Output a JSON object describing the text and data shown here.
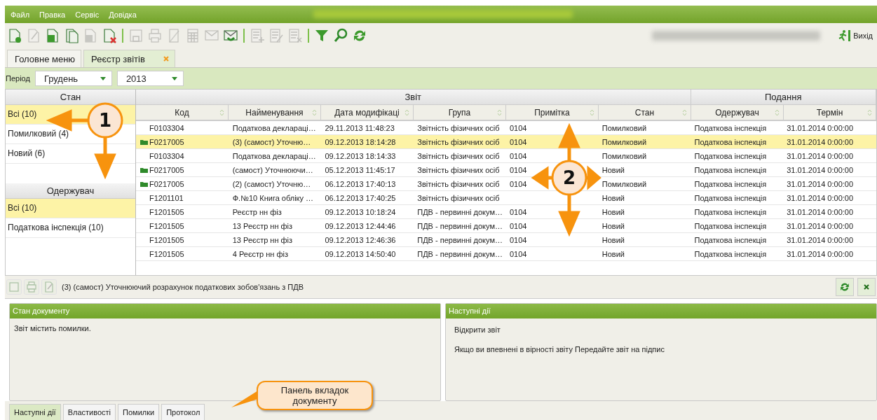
{
  "menu": [
    "Файл",
    "Правка",
    "Сервіс",
    "Довідка"
  ],
  "toolbar": [
    {
      "kind": "doc-add",
      "disabled": false
    },
    {
      "kind": "doc-edit",
      "disabled": true
    },
    {
      "kind": "doc-open",
      "disabled": false
    },
    {
      "kind": "doc-copy",
      "disabled": false
    },
    {
      "kind": "doc-sign",
      "disabled": true
    },
    {
      "kind": "doc-delete",
      "disabled": false
    },
    {
      "kind": "separator"
    },
    {
      "kind": "save",
      "disabled": true
    },
    {
      "kind": "print",
      "disabled": true
    },
    {
      "kind": "pen",
      "disabled": true
    },
    {
      "kind": "grid",
      "disabled": true
    },
    {
      "kind": "mail-send",
      "disabled": true
    },
    {
      "kind": "mail-receive",
      "disabled": false
    },
    {
      "kind": "separator"
    },
    {
      "kind": "list-add",
      "disabled": true
    },
    {
      "kind": "list-edit",
      "disabled": true
    },
    {
      "kind": "list-delete",
      "disabled": true
    },
    {
      "kind": "separator"
    },
    {
      "kind": "filter",
      "disabled": false
    },
    {
      "kind": "search",
      "disabled": false
    },
    {
      "kind": "refresh",
      "disabled": false
    }
  ],
  "exit_button": {
    "label": "Вихід"
  },
  "tabs": [
    {
      "label": "Головне меню",
      "selected": false,
      "closable": false
    },
    {
      "label": "Реєстр звітів",
      "selected": true,
      "closable": true
    }
  ],
  "period": {
    "label": "Період",
    "month": "Грудень",
    "year": "2013"
  },
  "filters": [
    {
      "title": "Стан",
      "items": [
        {
          "label": "Всі (10)",
          "selected": true
        },
        {
          "label": "Помилковий (4)",
          "selected": false
        },
        {
          "label": "Новий (6)",
          "selected": false
        }
      ]
    },
    {
      "title": "Одержувач",
      "items": [
        {
          "label": "Всі (10)",
          "selected": true
        },
        {
          "label": "Податкова інспекція (10)",
          "selected": false
        }
      ]
    }
  ],
  "table": {
    "column_groups": [
      {
        "label": "Звіт"
      },
      {
        "label": "Подання"
      }
    ],
    "columns": [
      "Код",
      "Найменування",
      "Дата модифікаці",
      "Група",
      "Примітка",
      "Стан",
      "Одержувач",
      "Термін"
    ],
    "rows": [
      {
        "folder": false,
        "selected": false,
        "cells": [
          "F0103304",
          "Податкова деклараці…",
          "29.11.2013 11:48:23",
          "Звітність фізичних осіб",
          "0104",
          "Помилковий",
          "Податкова інспекція",
          "31.01.2014 0:00:00"
        ]
      },
      {
        "folder": true,
        "selected": true,
        "cells": [
          "F0217005",
          "(3) (самост) Уточню…",
          "09.12.2013 18:14:28",
          "Звітність фізичних осіб",
          "0104",
          "Помилковий",
          "Податкова інспекція",
          "31.01.2014 0:00:00"
        ]
      },
      {
        "folder": false,
        "selected": false,
        "cells": [
          "F0103304",
          "Податкова деклараці…",
          "09.12.2013 18:14:33",
          "Звітність фізичних осіб",
          "0104",
          "Помилковий",
          "Податкова інспекція",
          "31.01.2014 0:00:00"
        ]
      },
      {
        "folder": true,
        "selected": false,
        "cells": [
          "F0217005",
          "(самост) Уточнюючи…",
          "05.12.2013 11:45:17",
          "Звітність фізичних осіб",
          "0104",
          "Новий",
          "Податкова інспекція",
          "31.01.2014 0:00:00"
        ]
      },
      {
        "folder": true,
        "selected": false,
        "cells": [
          "F0217005",
          "(2) (самост) Уточню…",
          "06.12.2013 17:40:13",
          "Звітність фізичних осіб",
          "0104",
          "Помилковий",
          "Податкова інспекція",
          "31.01.2014 0:00:00"
        ]
      },
      {
        "folder": false,
        "selected": false,
        "cells": [
          "F1201101",
          "Ф.№10 Книга обліку …",
          "06.12.2013 17:40:25",
          "Звітність фізичних осіб",
          "",
          "Новий",
          "Податкова інспекція",
          "31.01.2014 0:00:00"
        ]
      },
      {
        "folder": false,
        "selected": false,
        "cells": [
          "F1201505",
          "Реєстр нн фіз",
          "09.12.2013 10:18:24",
          "ПДВ - первинні докум…",
          "0104",
          "Новий",
          "Податкова інспекція",
          "31.01.2014 0:00:00"
        ]
      },
      {
        "folder": false,
        "selected": false,
        "cells": [
          "F1201505",
          "13 Реєстр нн фіз",
          "09.12.2013 12:44:46",
          "ПДВ - первинні докум…",
          "0104",
          "Новий",
          "Податкова інспекція",
          "31.01.2014 0:00:00"
        ]
      },
      {
        "folder": false,
        "selected": false,
        "cells": [
          "F1201505",
          "13 Реєстр нн фіз",
          "09.12.2013 12:46:36",
          "ПДВ - первинні докум…",
          "0104",
          "Новий",
          "Податкова інспекція",
          "31.01.2014 0:00:00"
        ]
      },
      {
        "folder": false,
        "selected": false,
        "cells": [
          "F1201505",
          "4 Реєстр нн фіз",
          "09.12.2013 14:50:40",
          "ПДВ - первинні докум…",
          "0104",
          "Новий",
          "Податкова інспекція",
          "31.01.2014 0:00:00"
        ]
      }
    ]
  },
  "doc_toolbar": {
    "buttons": [
      {
        "kind": "save",
        "disabled": true
      },
      {
        "kind": "print",
        "disabled": true
      },
      {
        "kind": "doc-edit",
        "disabled": true
      }
    ],
    "title": "(3) (самост) Уточнюючий розрахунок податкових зобов'язань з ПДВ",
    "right_buttons": [
      {
        "kind": "refresh",
        "disabled": false
      },
      {
        "kind": "close",
        "disabled": false
      }
    ]
  },
  "panels": [
    {
      "title": "Стан документу",
      "lines": [
        "Звіт містить помилки."
      ]
    },
    {
      "title": "Наступні дії",
      "lines": [
        "Відкрити звіт",
        "Якщо ви впевнені в вірності звіту Передайте звіт на підпис"
      ]
    }
  ],
  "bottom_tabs": [
    {
      "label": "Наступні дії",
      "selected": true
    },
    {
      "label": "Властивості",
      "selected": false
    },
    {
      "label": "Помилки",
      "selected": false
    },
    {
      "label": "Протокол",
      "selected": false
    }
  ],
  "annotations": [
    {
      "kind": "marker",
      "label": "1"
    },
    {
      "kind": "marker",
      "label": "2"
    },
    {
      "kind": "callout",
      "label": "Панель вкладок документу"
    }
  ]
}
